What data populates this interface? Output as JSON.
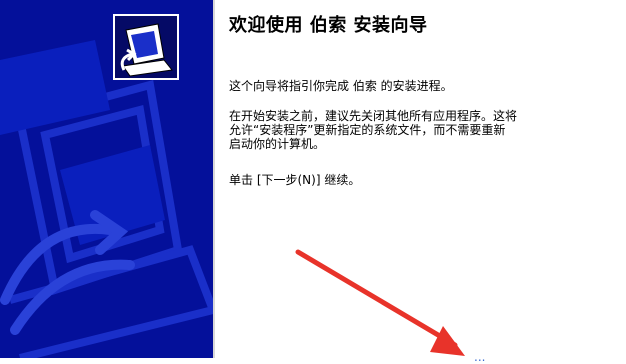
{
  "title": "欢迎使用 伯索 安装向导",
  "paragraphs": [
    "这个向导将指引你完成 伯索 的安装进程。",
    "在开始安装之前，建议先关闭其他所有应用程序。这将\n允许“安装程序”更新指定的系统文件，而不需要重新\n启动你的计算机。",
    "单击 [下一步(N)] 继续。"
  ],
  "bottom_partial_text": "...",
  "colors": {
    "sidebar": "#04109a",
    "annotation_arrow": "#e8332a",
    "partial_link": "#3a6bd0"
  },
  "icons": {
    "installer": "computer-setup-icon",
    "annotation": "red-arrow-annotation"
  }
}
